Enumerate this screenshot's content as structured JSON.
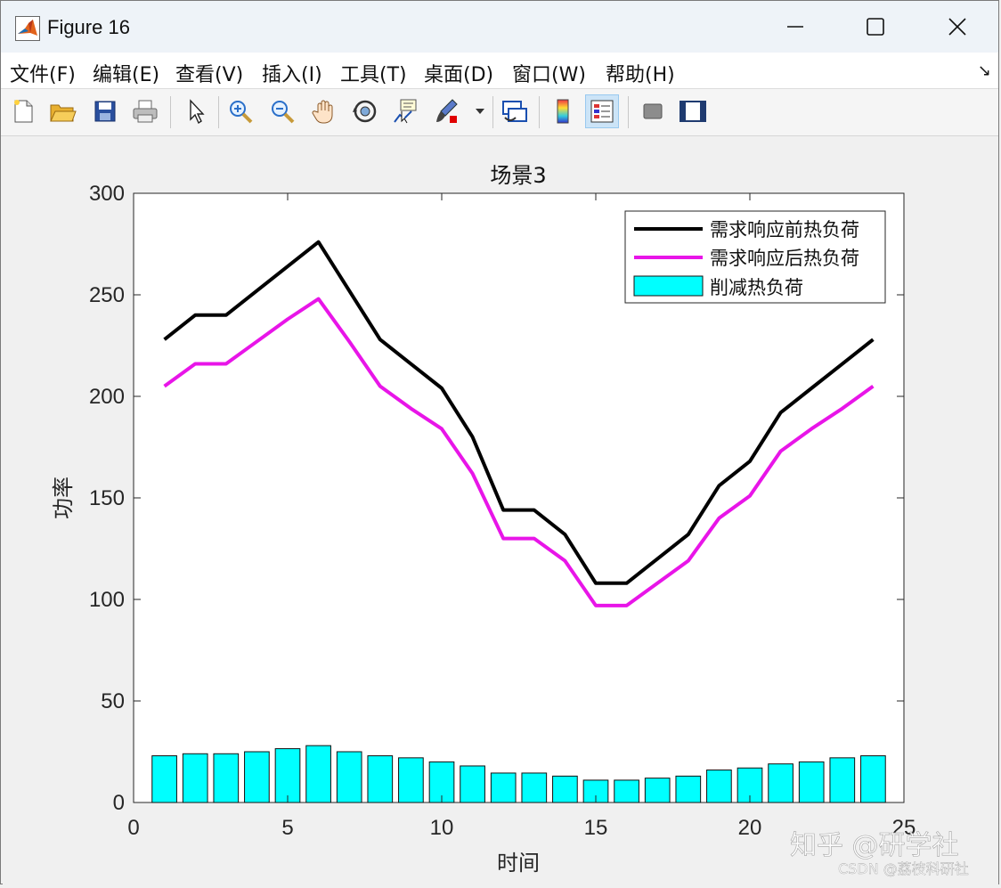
{
  "window": {
    "title": "Figure 16",
    "icons": [
      "matlab-logo-icon",
      "minimize-icon",
      "maximize-icon",
      "close-icon"
    ]
  },
  "menu": {
    "items": [
      "文件(F)",
      "编辑(E)",
      "查看(V)",
      "插入(I)",
      "工具(T)",
      "桌面(D)",
      "窗口(W)",
      "帮助(H)"
    ],
    "overflow_arrow": "↘"
  },
  "toolbar": {
    "buttons": [
      "new-figure-icon",
      "open-file-icon",
      "save-icon",
      "print-icon",
      "edit-plot-arrow-icon",
      "zoom-in-icon",
      "zoom-out-icon",
      "pan-hand-icon",
      "rotate-3d-icon",
      "data-cursor-icon",
      "brush-icon",
      "link-plot-icon",
      "colorbar-icon",
      "legend-icon",
      "hide-plot-tools-icon",
      "show-plot-tools-icon"
    ],
    "active": "legend-icon"
  },
  "colors": {
    "before": "#000000",
    "after": "#e815e8",
    "reduced": "#00ffff"
  },
  "chart_data": {
    "type": "line",
    "title": "场景3",
    "xlabel": "时间",
    "ylabel": "功率",
    "xlim": [
      0,
      25
    ],
    "ylim": [
      0,
      300
    ],
    "xticks": [
      0,
      5,
      10,
      15,
      20,
      25
    ],
    "yticks": [
      0,
      50,
      100,
      150,
      200,
      250,
      300
    ],
    "grid": false,
    "legend_position": "top-right",
    "x": [
      1,
      2,
      3,
      4,
      5,
      6,
      7,
      8,
      9,
      10,
      11,
      12,
      13,
      14,
      15,
      16,
      17,
      18,
      19,
      20,
      21,
      22,
      23,
      24
    ],
    "series": [
      {
        "name": "需求响应前热负荷",
        "type": "line",
        "values": [
          228,
          240,
          240,
          252,
          264,
          276,
          252,
          228,
          216,
          204,
          180,
          144,
          144,
          132,
          108,
          108,
          120,
          132,
          156,
          168,
          192,
          204,
          216,
          228
        ]
      },
      {
        "name": "需求响应后热负荷",
        "type": "line",
        "values": [
          205,
          216,
          216,
          227,
          238,
          248,
          227,
          205,
          194,
          184,
          162,
          130,
          130,
          119,
          97,
          97,
          108,
          119,
          140,
          151,
          173,
          184,
          194,
          205
        ]
      },
      {
        "name": "削减热负荷",
        "type": "bar",
        "values": [
          23,
          24,
          24,
          25,
          26.5,
          28,
          25,
          23,
          22,
          20,
          18,
          14.5,
          14.5,
          13,
          11,
          11,
          12,
          13,
          16,
          17,
          19,
          20,
          22,
          23
        ]
      }
    ]
  },
  "watermark": {
    "zhihu": "知乎 @研学社",
    "csdn": "CSDN @荔枝科研社"
  }
}
